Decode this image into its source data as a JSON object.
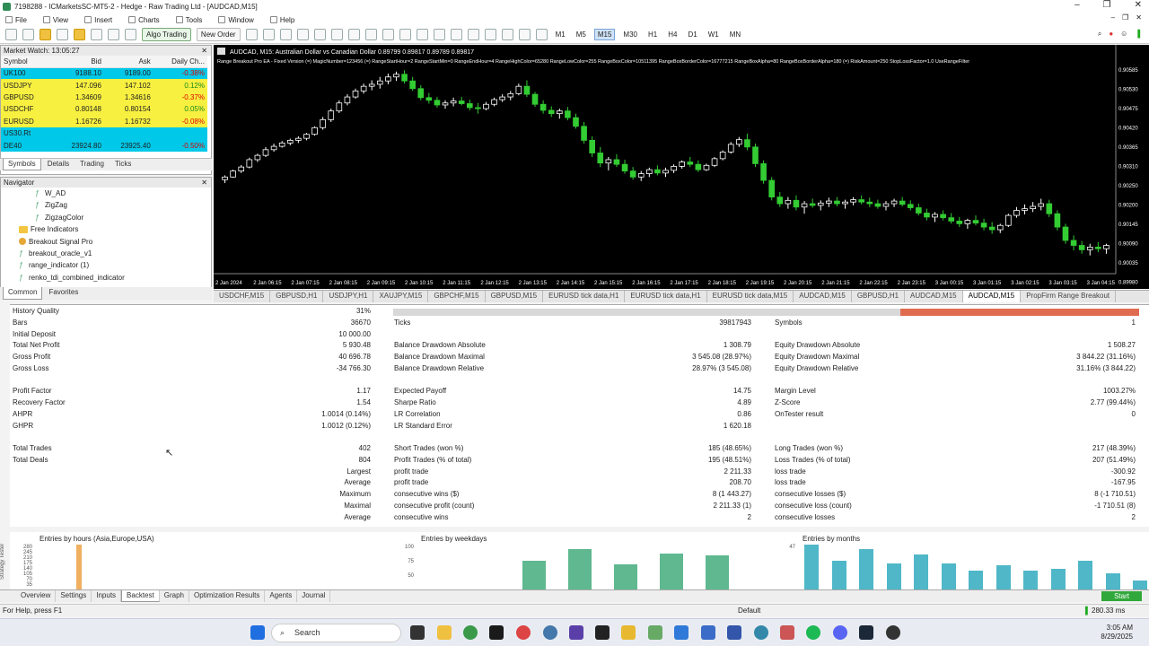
{
  "window": {
    "title": "7198288 - ICMarketsSC-MT5-2 - Hedge - Raw Trading Ltd - [AUDCAD,M15]"
  },
  "menu": [
    "File",
    "View",
    "Insert",
    "Charts",
    "Tools",
    "Window",
    "Help"
  ],
  "toolbar": {
    "algo_trading": "Algo Trading",
    "new_order": "New Order",
    "timeframes": [
      "M1",
      "M5",
      "M15",
      "M30",
      "H1",
      "H4",
      "D1",
      "W1",
      "MN"
    ],
    "active_timeframe": "M15"
  },
  "market_watch": {
    "title": "Market Watch: 13:05:27",
    "columns": [
      "Symbol",
      "Bid",
      "Ask",
      "Daily Ch..."
    ],
    "rows": [
      {
        "symbol": "UK100",
        "bid": "9188.10",
        "ask": "9189.00",
        "change": "-0.38%",
        "style": "cyan"
      },
      {
        "symbol": "USDJPY",
        "bid": "147.096",
        "ask": "147.102",
        "change": "0.12%",
        "style": "yellow"
      },
      {
        "symbol": "GBPUSD",
        "bid": "1.34609",
        "ask": "1.34616",
        "change": "-0.37%",
        "style": "yellow"
      },
      {
        "symbol": "USDCHF",
        "bid": "0.80148",
        "ask": "0.80154",
        "change": "0.05%",
        "style": "yellow"
      },
      {
        "symbol": "EURUSD",
        "bid": "1.16726",
        "ask": "1.16732",
        "change": "-0.08%",
        "style": "yellow"
      },
      {
        "symbol": "US30.Rt",
        "bid": "",
        "ask": "",
        "change": "",
        "style": "cyan"
      },
      {
        "symbol": "DE40",
        "bid": "23924.80",
        "ask": "23925.40",
        "change": "-0.50%",
        "style": "cyan"
      }
    ],
    "tabs": [
      "Symbols",
      "Details",
      "Trading",
      "Ticks"
    ]
  },
  "navigator": {
    "title": "Navigator",
    "items": [
      {
        "label": "W_AD",
        "kind": "fx",
        "indent": 38
      },
      {
        "label": "ZigZag",
        "kind": "fx",
        "indent": 38
      },
      {
        "label": "ZigzagColor",
        "kind": "fx",
        "indent": 38
      },
      {
        "label": "Free Indicators",
        "kind": "folder",
        "indent": 20
      },
      {
        "label": "Breakout Signal Pro",
        "kind": "ea",
        "indent": 20
      },
      {
        "label": "breakout_oracle_v1",
        "kind": "fx",
        "indent": 20
      },
      {
        "label": "range_indicator (1)",
        "kind": "fx",
        "indent": 20
      },
      {
        "label": "renko_tdi_combined_indicator",
        "kind": "fx",
        "indent": 20
      }
    ],
    "tabs": [
      "Common",
      "Favorites"
    ]
  },
  "chart": {
    "header": "AUDCAD, M15:  Australian Dollar vs Canadian Dollar  0.89799 0.89817 0.89789 0.89817",
    "ea_line": "Range Breakout Pro EA - Fixed Version (=) MagicNumber=123456 (=) RangeStartHour=2 RangeStartMin=0 RangeEndHour=4 RangeHighColor=65280 RangeLowColor=255 RangeBoxColor=10511395 RangeBoxBorderColor=16777215 RangeBoxAlpha=80 RangeBoxBorderAlpha=180 (=) RiskAmount=250 StopLossFactor=1.0 UseRangeFilter",
    "price_labels": [
      "0.90585",
      "0.90530",
      "0.90475",
      "0.90420",
      "0.90365",
      "0.90310",
      "0.90250",
      "0.90200",
      "0.90145",
      "0.90090",
      "0.90035",
      "0.89980"
    ],
    "time_labels": [
      "2 Jan 2024",
      "2 Jan 06:15",
      "2 Jan 07:15",
      "2 Jan 08:15",
      "2 Jan 09:15",
      "2 Jan 10:15",
      "2 Jan 11:15",
      "2 Jan 12:15",
      "2 Jan 13:15",
      "2 Jan 14:15",
      "2 Jan 15:15",
      "2 Jan 16:15",
      "2 Jan 17:15",
      "2 Jan 18:15",
      "2 Jan 19:15",
      "2 Jan 20:15",
      "2 Jan 21:15",
      "2 Jan 22:15",
      "2 Jan 23:15",
      "3 Jan 00:15",
      "3 Jan 01:15",
      "3 Jan 02:15",
      "3 Jan 03:15",
      "3 Jan 04:15"
    ],
    "tabs": [
      "USDCHF,M15",
      "GBPUSD,H1",
      "USDJPY,H1",
      "XAUJPY,M15",
      "GBPCHF,M15",
      "GBPUSD,M15",
      "EURUSD tick data,H1",
      "EURUSD tick data,H1",
      "EURUSD tick data,M15",
      "AUDCAD,M15",
      "GBPUSD,H1",
      "AUDCAD,M15",
      "AUDCAD,M15",
      "PropFirm Range Breakout"
    ],
    "active_tab_index": 12,
    "up_color": "#ffffff",
    "down_color": "#33cc33",
    "candles": [
      [
        90232,
        90245,
        90222,
        90240
      ],
      [
        90240,
        90262,
        90238,
        90258
      ],
      [
        90258,
        90276,
        90252,
        90270
      ],
      [
        90270,
        90298,
        90266,
        90292
      ],
      [
        90292,
        90310,
        90285,
        90305
      ],
      [
        90305,
        90330,
        90300,
        90322
      ],
      [
        90322,
        90340,
        90316,
        90332
      ],
      [
        90332,
        90348,
        90328,
        90342
      ],
      [
        90342,
        90355,
        90335,
        90350
      ],
      [
        90350,
        90362,
        90342,
        90356
      ],
      [
        90356,
        90372,
        90350,
        90368
      ],
      [
        90368,
        90392,
        90364,
        90388
      ],
      [
        90388,
        90420,
        90382,
        90412
      ],
      [
        90412,
        90445,
        90405,
        90438
      ],
      [
        90438,
        90470,
        90432,
        90462
      ],
      [
        90462,
        90488,
        90455,
        90480
      ],
      [
        90480,
        90505,
        90475,
        90498
      ],
      [
        90498,
        90520,
        90490,
        90512
      ],
      [
        90512,
        90530,
        90500,
        90518
      ],
      [
        90518,
        90540,
        90505,
        90528
      ],
      [
        90528,
        90550,
        90518,
        90540
      ],
      [
        90540,
        90556,
        90528,
        90548
      ],
      [
        90548,
        90560,
        90520,
        90528
      ],
      [
        90528,
        90540,
        90498,
        90505
      ],
      [
        90505,
        90515,
        90470,
        90478
      ],
      [
        90478,
        90492,
        90460,
        90470
      ],
      [
        90470,
        90480,
        90448,
        90456
      ],
      [
        90456,
        90470,
        90445,
        90462
      ],
      [
        90462,
        90478,
        90452,
        90468
      ],
      [
        90468,
        90480,
        90455,
        90460
      ],
      [
        90460,
        90472,
        90440,
        90448
      ],
      [
        90448,
        90462,
        90430,
        90445
      ],
      [
        90445,
        90465,
        90440,
        90458
      ],
      [
        90458,
        90478,
        90452,
        90472
      ],
      [
        90472,
        90488,
        90465,
        90480
      ],
      [
        90480,
        90498,
        90470,
        90490
      ],
      [
        90490,
        90520,
        90485,
        90512
      ],
      [
        90512,
        90530,
        90480,
        90488
      ],
      [
        90488,
        90495,
        90450,
        90458
      ],
      [
        90458,
        90470,
        90430,
        90440
      ],
      [
        90440,
        90452,
        90420,
        90430
      ],
      [
        90430,
        90445,
        90415,
        90438
      ],
      [
        90438,
        90450,
        90410,
        90418
      ],
      [
        90418,
        90430,
        90385,
        90392
      ],
      [
        90392,
        90405,
        90340,
        90350
      ],
      [
        90350,
        90362,
        90300,
        90312
      ],
      [
        90312,
        90330,
        90270,
        90282
      ],
      [
        90282,
        90300,
        90260,
        90292
      ],
      [
        90292,
        90308,
        90270,
        90278
      ],
      [
        90278,
        90292,
        90250,
        90258
      ],
      [
        90258,
        90270,
        90232,
        90240
      ],
      [
        90240,
        90258,
        90228,
        90250
      ],
      [
        90250,
        90268,
        90240,
        90262
      ],
      [
        90262,
        90275,
        90245,
        90252
      ],
      [
        90252,
        90268,
        90240,
        90260
      ],
      [
        90260,
        90278,
        90252,
        90272
      ],
      [
        90272,
        90290,
        90265,
        90285
      ],
      [
        90285,
        90300,
        90270,
        90278
      ],
      [
        90278,
        90290,
        90255,
        90262
      ],
      [
        90262,
        90280,
        90258,
        90275
      ],
      [
        90275,
        90300,
        90270,
        90295
      ],
      [
        90295,
        90320,
        90290,
        90315
      ],
      [
        90315,
        90345,
        90310,
        90338
      ],
      [
        90338,
        90360,
        90330,
        90352
      ],
      [
        90352,
        90370,
        90320,
        90330
      ],
      [
        90330,
        90340,
        90270,
        90280
      ],
      [
        90280,
        90290,
        90220,
        90230
      ],
      [
        90230,
        90240,
        90170,
        90180
      ],
      [
        90180,
        90195,
        90150,
        90160
      ],
      [
        90160,
        90180,
        90145,
        90170
      ],
      [
        90170,
        90185,
        90140,
        90150
      ],
      [
        90150,
        90168,
        90130,
        90160
      ],
      [
        90160,
        90175,
        90148,
        90155
      ],
      [
        90155,
        90170,
        90140,
        90162
      ],
      [
        90162,
        90178,
        90150,
        90168
      ],
      [
        90168,
        90180,
        90152,
        90160
      ],
      [
        90160,
        90172,
        90145,
        90165
      ],
      [
        90165,
        90180,
        90155,
        90172
      ],
      [
        90172,
        90185,
        90158,
        90165
      ],
      [
        90165,
        90178,
        90150,
        90160
      ],
      [
        90160,
        90172,
        90145,
        90152
      ],
      [
        90152,
        90168,
        90140,
        90160
      ],
      [
        90160,
        90175,
        90150,
        90168
      ],
      [
        90168,
        90180,
        90152,
        90158
      ],
      [
        90158,
        90170,
        90140,
        90148
      ],
      [
        90148,
        90160,
        90125,
        90132
      ],
      [
        90132,
        90145,
        90110,
        90120
      ],
      [
        90120,
        90135,
        90105,
        90128
      ],
      [
        90128,
        90140,
        90110,
        90118
      ],
      [
        90118,
        90132,
        90100,
        90108
      ],
      [
        90108,
        90120,
        90090,
        90100
      ],
      [
        90100,
        90115,
        90085,
        90110
      ],
      [
        90110,
        90125,
        90095,
        90102
      ],
      [
        90102,
        90115,
        90080,
        90090
      ],
      [
        90090,
        90105,
        90070,
        90082
      ],
      [
        90082,
        90100,
        90072,
        90095
      ],
      [
        90095,
        90130,
        90090,
        90125
      ],
      [
        90125,
        90150,
        90118,
        90140
      ],
      [
        90140,
        90158,
        90128,
        90145
      ],
      [
        90145,
        90165,
        90135,
        90152
      ],
      [
        90152,
        90175,
        90140,
        90160
      ],
      [
        90160,
        90172,
        90120,
        90130
      ],
      [
        90130,
        90140,
        90080,
        90090
      ],
      [
        90090,
        90100,
        90040,
        90050
      ],
      [
        90050,
        90065,
        90020,
        90035
      ],
      [
        90035,
        90048,
        90010,
        90022
      ],
      [
        90022,
        90040,
        90005,
        90030
      ],
      [
        90030,
        90045,
        90015,
        90025
      ],
      [
        90025,
        90040,
        90010,
        90035
      ]
    ]
  },
  "report": {
    "rows": [
      {
        "l1": "History Quality",
        "v1": "31%",
        "l2": "",
        "v2": "",
        "l3": "",
        "v3": "",
        "bar": true
      },
      {
        "l1": "Bars",
        "v1": "36670",
        "l2": "Ticks",
        "v2": "39817943",
        "l3": "Symbols",
        "v3": "1"
      },
      {
        "l1": "Initial Deposit",
        "v1": "10 000.00",
        "l2": "",
        "v2": "",
        "l3": "",
        "v3": ""
      },
      {
        "l1": "Total Net Profit",
        "v1": "5 930.48",
        "l2": "Balance Drawdown Absolute",
        "v2": "1 308.79",
        "l3": "Equity Drawdown Absolute",
        "v3": "1 508.27"
      },
      {
        "l1": "Gross Profit",
        "v1": "40 696.78",
        "l2": "Balance Drawdown Maximal",
        "v2": "3 545.08 (28.97%)",
        "l3": "Equity Drawdown Maximal",
        "v3": "3 844.22 (31.16%)"
      },
      {
        "l1": "Gross Loss",
        "v1": "-34 766.30",
        "l2": "Balance Drawdown Relative",
        "v2": "28.97% (3 545.08)",
        "l3": "Equity Drawdown Relative",
        "v3": "31.16% (3 844.22)"
      },
      {
        "l1": "",
        "v1": "",
        "l2": "",
        "v2": "",
        "l3": "",
        "v3": ""
      },
      {
        "l1": "Profit Factor",
        "v1": "1.17",
        "l2": "Expected Payoff",
        "v2": "14.75",
        "l3": "Margin Level",
        "v3": "1003.27%"
      },
      {
        "l1": "Recovery Factor",
        "v1": "1.54",
        "l2": "Sharpe Ratio",
        "v2": "4.89",
        "l3": "Z-Score",
        "v3": "2.77 (99.44%)"
      },
      {
        "l1": "AHPR",
        "v1": "1.0014 (0.14%)",
        "l2": "LR Correlation",
        "v2": "0.86",
        "l3": "OnTester result",
        "v3": "0"
      },
      {
        "l1": "GHPR",
        "v1": "1.0012 (0.12%)",
        "l2": "LR Standard Error",
        "v2": "1 620.18",
        "l3": "",
        "v3": ""
      },
      {
        "l1": "",
        "v1": "",
        "l2": "",
        "v2": "",
        "l3": "",
        "v3": ""
      },
      {
        "l1": "Total Trades",
        "v1": "402",
        "l2": "Short Trades (won %)",
        "v2": "185 (48.65%)",
        "l3": "Long Trades (won %)",
        "v3": "217 (48.39%)"
      },
      {
        "l1": "Total Deals",
        "v1": "804",
        "l2": "Profit Trades (% of total)",
        "v2": "195 (48.51%)",
        "l3": "Loss Trades (% of total)",
        "v3": "207 (51.49%)"
      },
      {
        "l1": "",
        "v1": "Largest",
        "l2": "profit trade",
        "v2": "2 211.33",
        "l3": "loss trade",
        "v3": "-300.92"
      },
      {
        "l1": "",
        "v1": "Average",
        "l2": "profit trade",
        "v2": "208.70",
        "l3": "loss trade",
        "v3": "-167.95"
      },
      {
        "l1": "",
        "v1": "Maximum",
        "l2": "consecutive wins ($)",
        "v2": "8 (1 443.27)",
        "l3": "consecutive losses ($)",
        "v3": "8 (-1 710.51)"
      },
      {
        "l1": "",
        "v1": "Maximal",
        "l2": "consecutive profit (count)",
        "v2": "2 211.33 (1)",
        "l3": "consecutive loss (count)",
        "v3": "-1 710.51 (8)"
      },
      {
        "l1": "",
        "v1": "Average",
        "l2": "consecutive wins",
        "v2": "2",
        "l3": "consecutive losses",
        "v3": "2"
      }
    ]
  },
  "histograms": [
    {
      "title": "Entries by hours (Asia,Europe,USA)",
      "ticks": [
        "280",
        "245",
        "210",
        "175",
        "140",
        "105",
        "70",
        "35"
      ],
      "values": [
        0,
        0,
        0,
        402,
        0,
        0,
        0,
        0,
        0,
        0,
        0,
        0,
        0,
        0,
        0,
        0,
        0,
        0,
        0,
        0,
        0,
        0,
        0,
        0
      ],
      "max": 280,
      "color": "#f0b060"
    },
    {
      "title": "Entries by weekdays",
      "ticks": [
        "100",
        "75",
        "50"
      ],
      "values": [
        0,
        78,
        94,
        74,
        88,
        86,
        0
      ],
      "max": 100,
      "min": 40,
      "color": "#5fb88f"
    },
    {
      "title": "Entries by months",
      "ticks": [
        "47"
      ],
      "values": [
        47,
        30,
        42,
        27,
        37,
        27,
        20,
        25,
        20,
        22,
        30,
        17,
        9
      ],
      "max": 47,
      "color": "#4fb7c8"
    }
  ],
  "bottom_tabs": [
    "Overview",
    "Settings",
    "Inputs",
    "Backtest",
    "Graph",
    "Optimization Results",
    "Agents",
    "Journal"
  ],
  "bottom_active": "Backtest",
  "start_label": "Start",
  "strategy_tester_label": "Strategy Tester",
  "status": {
    "help": "For Help, press F1",
    "profile": "Default",
    "ping": "280.33 ms"
  },
  "taskbar": {
    "search": "Search",
    "time": "3:05 AM",
    "date": "8/29/2025"
  }
}
